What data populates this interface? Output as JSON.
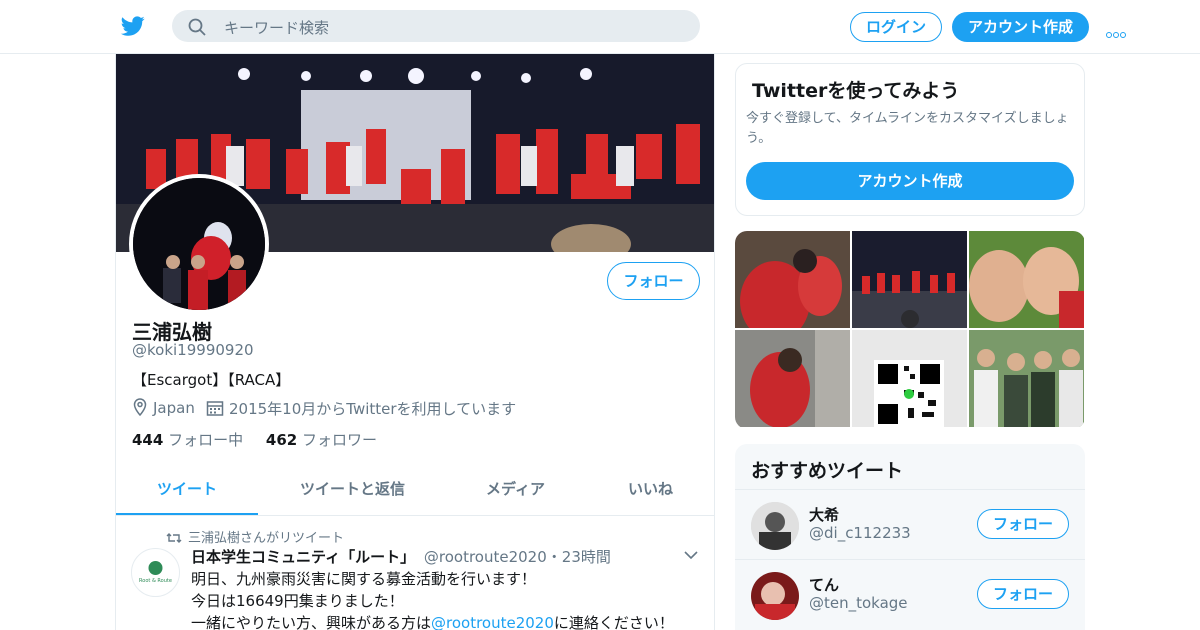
{
  "header": {
    "search_placeholder": "キーワード検索",
    "login_label": "ログイン",
    "signup_label": "アカウント作成"
  },
  "profile": {
    "name": "三浦弘樹",
    "handle": "@koki19990920",
    "bio": "【Escargot】【RACA】",
    "location": "Japan",
    "joined": "2015年10月からTwitterを利用しています",
    "following_count": "444",
    "following_label": "フォロー中",
    "followers_count": "462",
    "followers_label": "フォロワー",
    "follow_label": "フォロー"
  },
  "tabs": [
    {
      "label": "ツイート",
      "active": true
    },
    {
      "label": "ツイートと返信",
      "active": false
    },
    {
      "label": "メディア",
      "active": false
    },
    {
      "label": "いいね",
      "active": false
    }
  ],
  "tweet": {
    "retweet_note": "三浦弘樹さんがリツイート",
    "author": "日本学生コミュニティ「ルート」",
    "handle": "@rootroute2020",
    "time": "・23時間",
    "line1": "明日、九州豪雨災害に関する募金活動を行います！",
    "line2": "今日は16649円集まりました！",
    "line3_pre": "一緒にやりたい方、興味がある方は",
    "line3_link": "@rootroute2020",
    "line3_post": "に連絡ください！",
    "avatar_text": "Root & Route"
  },
  "signup_card": {
    "title": "Twitterを使ってみよう",
    "text": "今すぐ登録して、タイムラインをカスタマイズしましょう。",
    "button": "アカウント作成"
  },
  "recommend": {
    "title": "おすすめツイート",
    "users": [
      {
        "name": "大希",
        "handle": "@di_c112233",
        "follow": "フォロー"
      },
      {
        "name": "てん",
        "handle": "@ten_tokage",
        "follow": "フォロー"
      }
    ]
  },
  "colors": {
    "accent": "#1da1f2",
    "text": "#14171a",
    "muted": "#657786",
    "border": "#e6ecf0"
  }
}
